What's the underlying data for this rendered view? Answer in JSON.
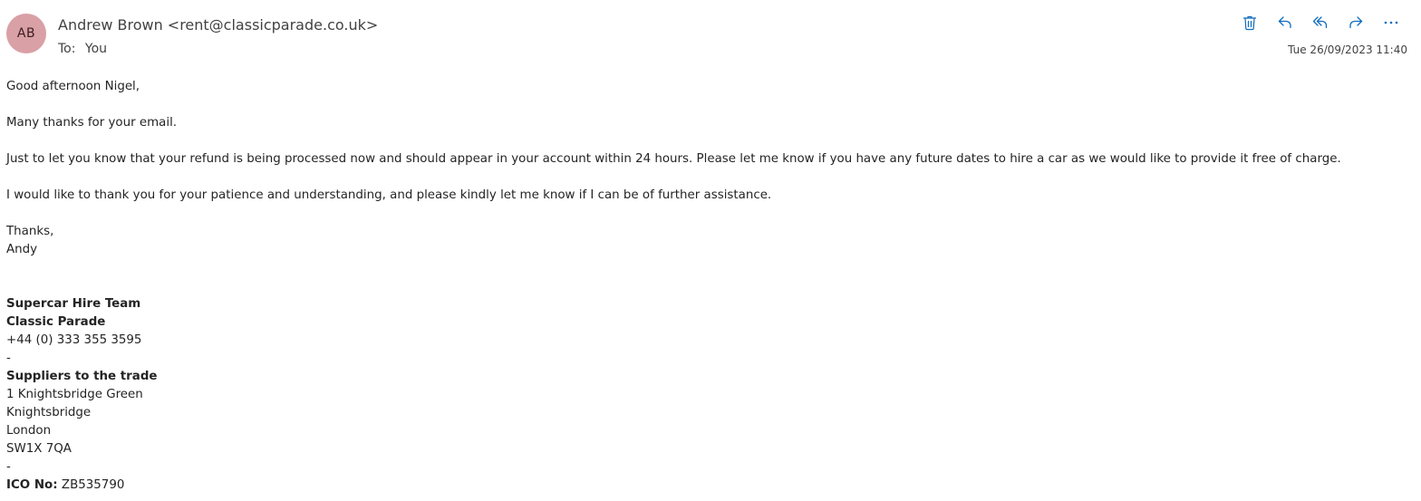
{
  "header": {
    "avatar_initials": "AB",
    "sender": "Andrew Brown <rent@classicparade.co.uk>",
    "to_label": "To:",
    "to_value": "You",
    "timestamp": "Tue 26/09/2023 11:40",
    "accent_color": "#0f6cbd",
    "avatar_color": "#d9a0a6",
    "actions": [
      {
        "icon": "trash-icon"
      },
      {
        "icon": "reply-icon"
      },
      {
        "icon": "reply-all-icon"
      },
      {
        "icon": "forward-icon"
      },
      {
        "icon": "more-icon"
      }
    ]
  },
  "message": {
    "greeting": "Good afternoon Nigel,",
    "para1": "Many thanks for your email.",
    "para2": "Just to let you know that your refund is being processed now and should appear in your account within 24 hours. Please let me know if you have any future dates to hire a car as we would like to provide it free of charge.",
    "para3": "I would like to thank you for your patience and understanding, and please kindly let me know if I can be of further assistance.",
    "signoff": "Thanks,",
    "signoff_name": "Andy"
  },
  "signature": {
    "team": "Supercar Hire Team",
    "company": "Classic Parade",
    "phone": "+44 (0) 333 355 3595",
    "separator": "-",
    "trade_heading": "Suppliers to the trade",
    "address1": "1 Knightsbridge Green",
    "address2": "Knightsbridge",
    "address3": "London",
    "postcode": "SW1X 7QA",
    "ico_label": "ICO No:",
    "ico_value": "ZB535790"
  }
}
